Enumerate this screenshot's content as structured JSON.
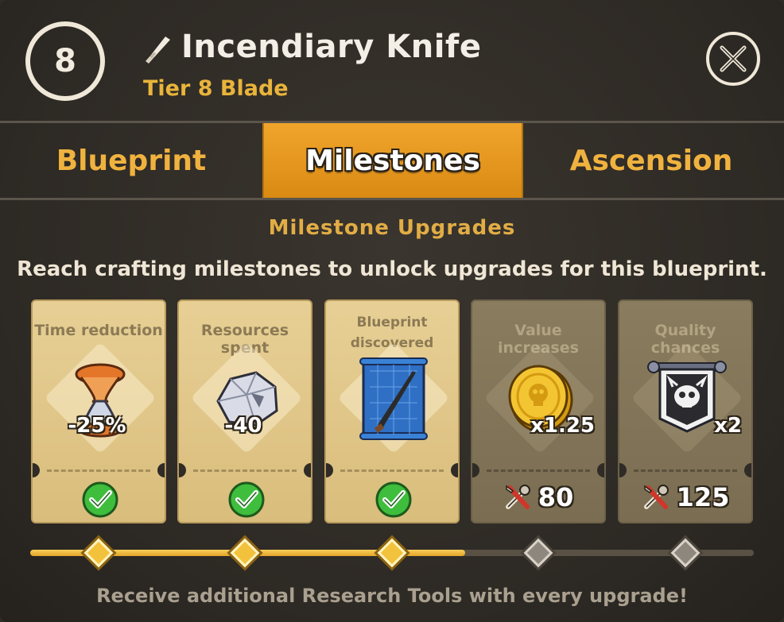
{
  "header": {
    "tier_number": "8",
    "title": "Incendiary Knife",
    "subtitle": "Tier 8 Blade"
  },
  "tabs": [
    {
      "label": "Blueprint",
      "active": false
    },
    {
      "label": "Milestones",
      "active": true
    },
    {
      "label": "Ascension",
      "active": false
    }
  ],
  "section": {
    "title": "Milestone Upgrades",
    "description": "Reach crafting milestones to unlock upgrades for this blueprint."
  },
  "milestones": [
    {
      "label": "Time reduction",
      "value": "-25%",
      "icon": "hourglass-icon",
      "unlocked": true
    },
    {
      "label": "Resources spent",
      "value": "-40",
      "icon": "ore-icon",
      "unlocked": true
    },
    {
      "label_line1": "Blueprint",
      "label_line2": "discovered",
      "value": "",
      "icon": "blueprint-icon",
      "unlocked": true
    },
    {
      "label": "Value increases",
      "value": "x1.25",
      "icon": "gold-coin-icon",
      "unlocked": false,
      "cost": "80"
    },
    {
      "label": "Quality chances",
      "value": "x2",
      "icon": "skull-banner-icon",
      "unlocked": false,
      "cost": "125"
    }
  ],
  "progress": {
    "completed": 3,
    "total": 5
  },
  "footer": "Receive additional Research Tools with every upgrade!",
  "colors": {
    "accent": "#f0b23f",
    "active_tab": "#e89a1e",
    "subtitle": "#e9b43b"
  }
}
